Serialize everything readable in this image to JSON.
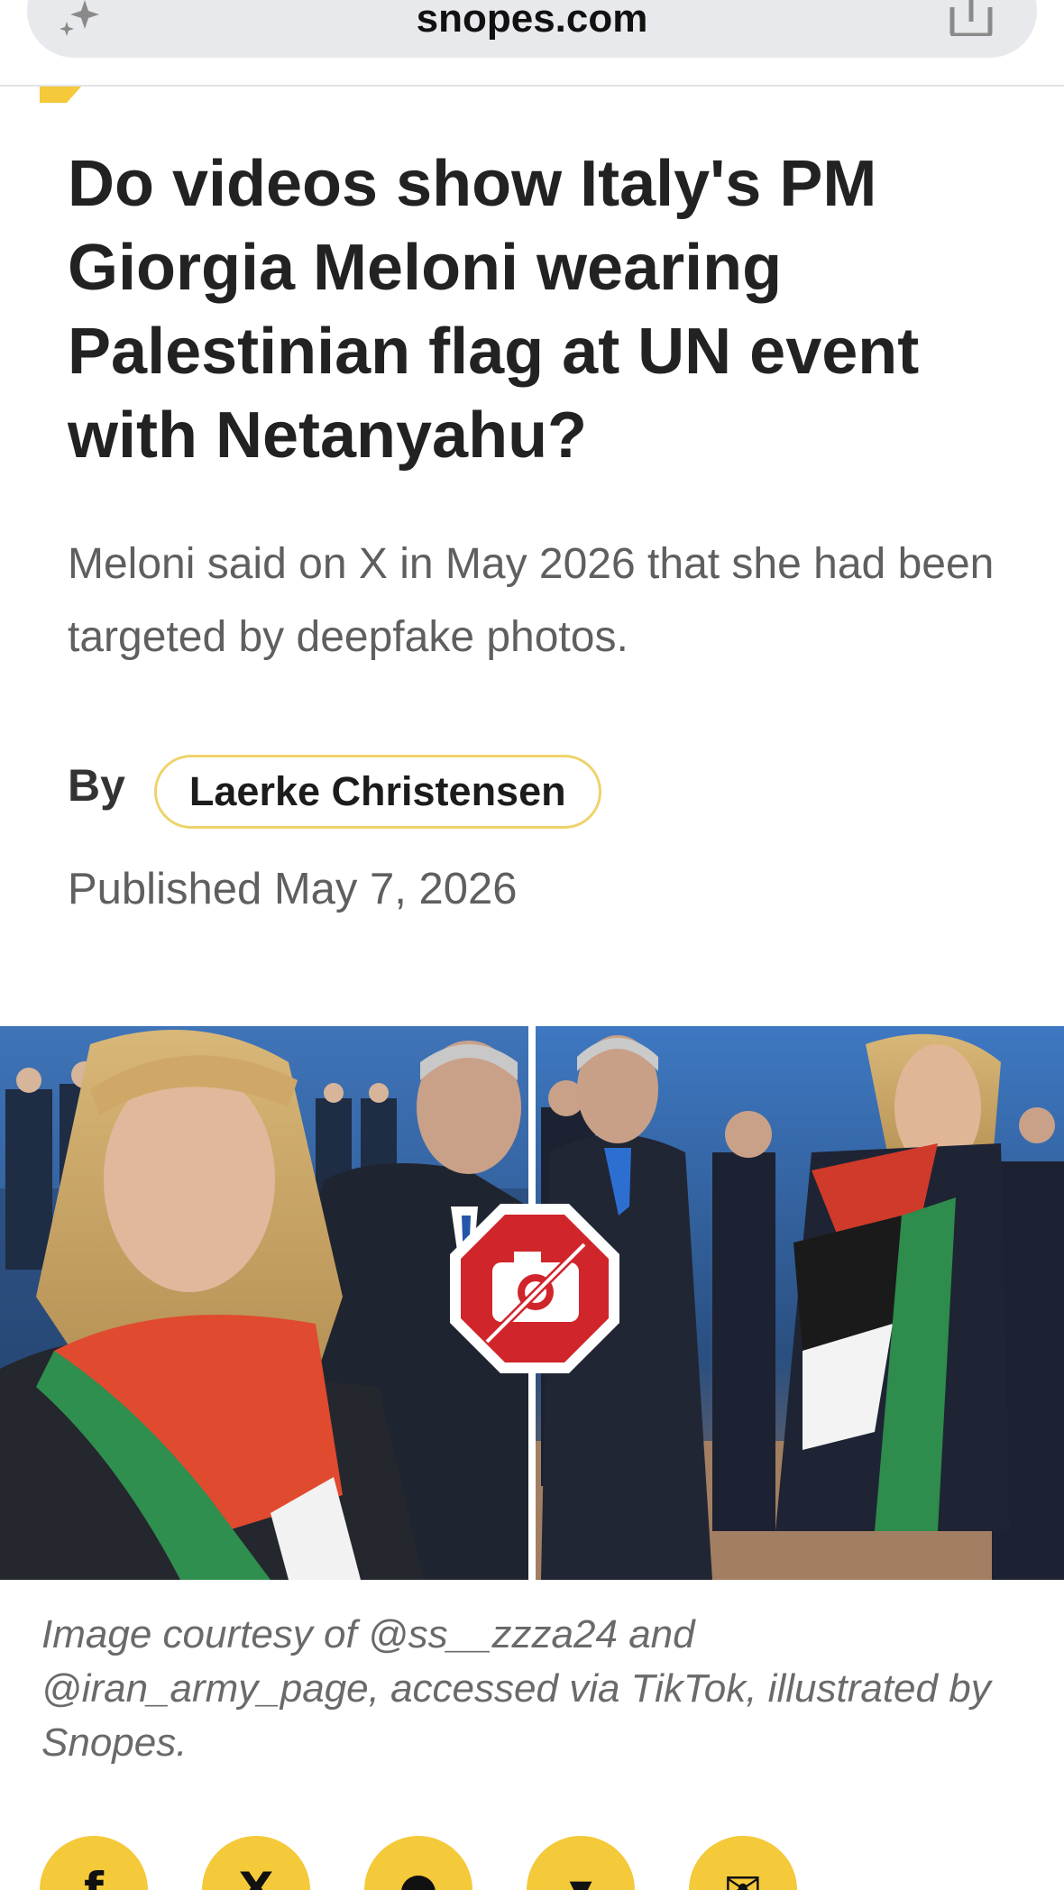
{
  "browser": {
    "url": "snopes.com"
  },
  "article": {
    "title": "Do videos show Italy's PM Giorgia Meloni wearing Palestinian flag at UN event with Netanyahu?",
    "subhead": "Meloni said on X in May 2026 that she had been targeted by deepfake photos.",
    "by_label": "By",
    "author": "Laerke Christensen",
    "published": "Published May 7, 2026",
    "image_caption": "Image courtesy of @ss__zzza24 and @iran_army_page, accessed via TikTok, illustrated by Snopes."
  },
  "share_buttons": [
    {
      "name": "facebook",
      "glyph": "f"
    },
    {
      "name": "x",
      "glyph": "X"
    },
    {
      "name": "reddit",
      "glyph": "●"
    },
    {
      "name": "bluesky",
      "glyph": "▾"
    },
    {
      "name": "email",
      "glyph": "✉"
    }
  ],
  "colors": {
    "accent": "#f4c93a",
    "pill_border": "#eed36a",
    "fake_badge": "#d0252b"
  }
}
